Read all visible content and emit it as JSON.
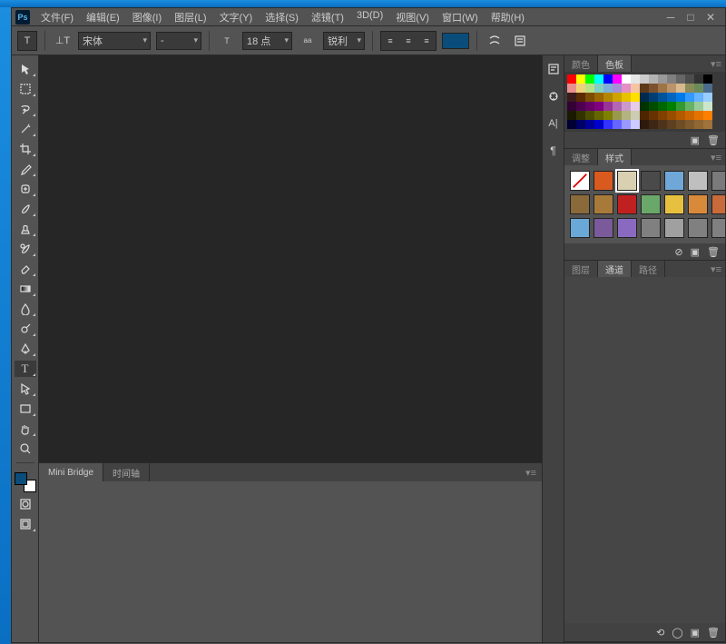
{
  "app": {
    "logo": "Ps"
  },
  "menu": [
    "文件(F)",
    "编辑(E)",
    "图像(I)",
    "图层(L)",
    "文字(Y)",
    "选择(S)",
    "滤镜(T)",
    "3D(D)",
    "视图(V)",
    "窗口(W)",
    "帮助(H)"
  ],
  "options": {
    "font_family": "宋体",
    "font_style": "-",
    "font_size": "18 点",
    "anti_alias": "锐利",
    "color": "#0a4d7a"
  },
  "bottom_tabs": [
    "Mini Bridge",
    "时间轴"
  ],
  "right": {
    "color_tabs": [
      "颜色",
      "色板"
    ],
    "adjust_tabs": [
      "调整",
      "样式"
    ],
    "layers_tabs": [
      "图层",
      "通道",
      "路径"
    ]
  },
  "swatches": [
    "#ff0000",
    "#ffff00",
    "#00ff00",
    "#00ffff",
    "#0000ff",
    "#ff00ff",
    "#ffffff",
    "#e6e6e6",
    "#cccccc",
    "#b3b3b3",
    "#999999",
    "#808080",
    "#666666",
    "#4d4d4d",
    "#333333",
    "#000000",
    "#ea8f8f",
    "#eed27a",
    "#b6e08a",
    "#7fd1c2",
    "#7faed6",
    "#a58fd6",
    "#e48fc6",
    "#f5c4a3",
    "#5c3a1a",
    "#7a5230",
    "#9e7446",
    "#bc9469",
    "#d9b98f",
    "#8c8c5a",
    "#6b8c5a",
    "#4a6b8c",
    "#3a1a1a",
    "#5a2a00",
    "#7a4d00",
    "#996600",
    "#b38600",
    "#cca300",
    "#e6c200",
    "#ffe000",
    "#002a4d",
    "#003d73",
    "#005299",
    "#0066bf",
    "#007ae6",
    "#3399ff",
    "#66b3ff",
    "#99ccff",
    "#330033",
    "#4d004d",
    "#660066",
    "#800080",
    "#993399",
    "#b366b3",
    "#cc99cc",
    "#e6cce6",
    "#003300",
    "#004d00",
    "#006600",
    "#008000",
    "#339933",
    "#66b366",
    "#99cc99",
    "#cce6cc",
    "#1a1a00",
    "#333300",
    "#4d4d00",
    "#666600",
    "#808000",
    "#99994d",
    "#b3b380",
    "#ccccb3",
    "#4d2600",
    "#663300",
    "#804000",
    "#994d00",
    "#b35900",
    "#cc6600",
    "#e67300",
    "#ff8000",
    "#000033",
    "#000066",
    "#000099",
    "#0000cc",
    "#3333ff",
    "#6666ff",
    "#9999ff",
    "#ccccff",
    "#2d1a0d",
    "#3d2613",
    "#4d331a",
    "#5e4020",
    "#6e4d26",
    "#7f5a2d",
    "#906633",
    "#a0733a"
  ],
  "styles_colors": [
    "#ffffff",
    "#d85a1e",
    "#d8d0b0",
    "#4a4a4a",
    "#6fa8d8",
    "#bfbfbf",
    "#7a7a7a",
    "#8a6a3a",
    "#a87a3a",
    "#c02020",
    "#6aa86a",
    "#e8c040",
    "#d88a3a",
    "#c86a3a",
    "#6aa8d8",
    "#7a5a9a",
    "#8a6ac0",
    "#808080",
    "#a0a0a0",
    "#808080",
    "#808080"
  ]
}
